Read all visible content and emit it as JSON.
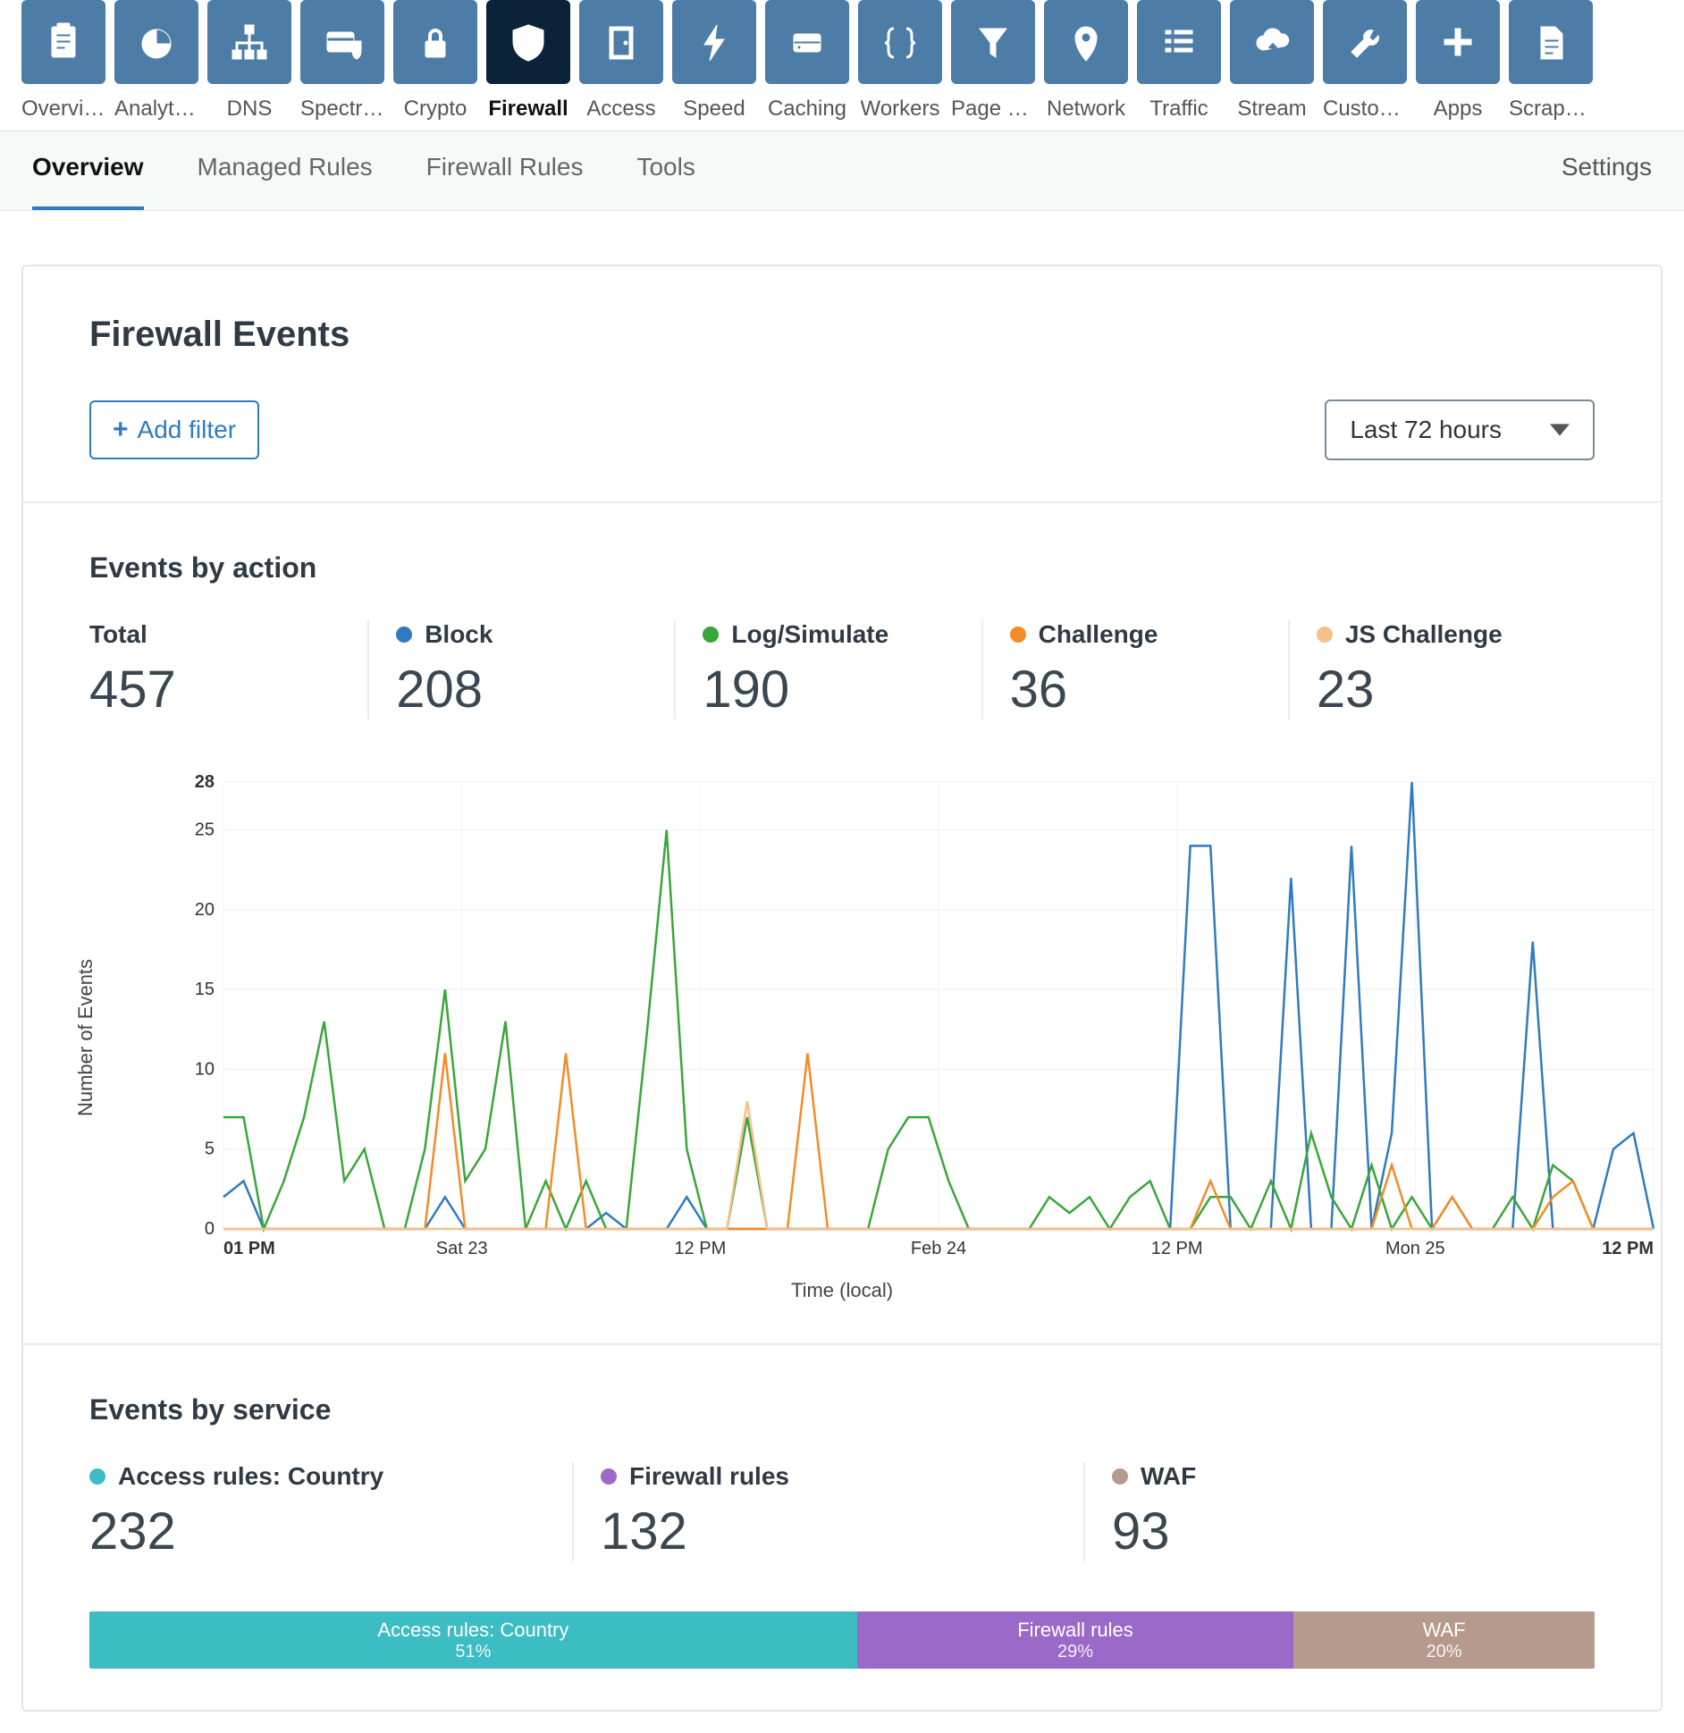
{
  "topnav": [
    {
      "label": "Overview",
      "icon": "clipboard"
    },
    {
      "label": "Analytics",
      "icon": "pie"
    },
    {
      "label": "DNS",
      "icon": "tree"
    },
    {
      "label": "Spectrum",
      "icon": "card-shield"
    },
    {
      "label": "Crypto",
      "icon": "lock"
    },
    {
      "label": "Firewall",
      "icon": "shield",
      "active": true
    },
    {
      "label": "Access",
      "icon": "door"
    },
    {
      "label": "Speed",
      "icon": "bolt"
    },
    {
      "label": "Caching",
      "icon": "drive"
    },
    {
      "label": "Workers",
      "icon": "braces"
    },
    {
      "label": "Page Rules",
      "icon": "funnel"
    },
    {
      "label": "Network",
      "icon": "pin"
    },
    {
      "label": "Traffic",
      "icon": "list"
    },
    {
      "label": "Stream",
      "icon": "cloud"
    },
    {
      "label": "Custom P…",
      "icon": "wrench"
    },
    {
      "label": "Apps",
      "icon": "plus"
    },
    {
      "label": "Scrape S…",
      "icon": "doc"
    }
  ],
  "subtabs": [
    "Overview",
    "Managed Rules",
    "Firewall Rules",
    "Tools"
  ],
  "subtab_active": "Overview",
  "settings_label": "Settings",
  "header": {
    "title": "Firewall Events",
    "add_filter": "Add filter",
    "time_range": "Last 72 hours"
  },
  "events_by_action": {
    "title": "Events by action",
    "stats": [
      {
        "label": "Total",
        "value": 457,
        "color": null
      },
      {
        "label": "Block",
        "value": 208,
        "color": "#2f7bbf"
      },
      {
        "label": "Log/Simulate",
        "value": 190,
        "color": "#3aa63a"
      },
      {
        "label": "Challenge",
        "value": 36,
        "color": "#f28c28"
      },
      {
        "label": "JS Challenge",
        "value": 23,
        "color": "#f6c08b"
      }
    ]
  },
  "events_by_service": {
    "title": "Events by service",
    "stats": [
      {
        "label": "Access rules: Country",
        "value": 232,
        "pct": "51%",
        "color": "#3cbcc3"
      },
      {
        "label": "Firewall rules",
        "value": 132,
        "pct": "29%",
        "color": "#9b69c7"
      },
      {
        "label": "WAF",
        "value": 93,
        "pct": "20%",
        "color": "#b59a8d"
      }
    ]
  },
  "chart_data": {
    "type": "line",
    "title": "",
    "xlabel": "Time (local)",
    "ylabel": "Number of Events",
    "ylim": [
      0,
      28
    ],
    "y_ticks": [
      0,
      5,
      10,
      15,
      20,
      25,
      28
    ],
    "x_ticks": [
      "01 PM",
      "Sat 23",
      "12 PM",
      "Feb 24",
      "12 PM",
      "Mon 25",
      "12 PM"
    ],
    "x_count": 72,
    "series": [
      {
        "name": "Block",
        "color": "#2f7bbf",
        "values": [
          2,
          3,
          0,
          0,
          0,
          0,
          0,
          0,
          0,
          0,
          0,
          2,
          0,
          0,
          0,
          0,
          0,
          0,
          0,
          1,
          0,
          0,
          0,
          2,
          0,
          0,
          0,
          0,
          0,
          0,
          0,
          0,
          0,
          0,
          0,
          0,
          0,
          0,
          0,
          0,
          0,
          0,
          0,
          0,
          0,
          0,
          0,
          0,
          24,
          24,
          0,
          0,
          0,
          22,
          0,
          0,
          24,
          0,
          6,
          28,
          0,
          0,
          0,
          0,
          0,
          18,
          0,
          0,
          0,
          5,
          6,
          0
        ]
      },
      {
        "name": "Log/Simulate",
        "color": "#3aa63a",
        "values": [
          7,
          7,
          0,
          3,
          7,
          13,
          3,
          5,
          0,
          0,
          5,
          15,
          3,
          5,
          13,
          0,
          3,
          0,
          3,
          0,
          0,
          12,
          25,
          5,
          0,
          0,
          7,
          0,
          0,
          0,
          0,
          0,
          0,
          5,
          7,
          7,
          3,
          0,
          0,
          0,
          0,
          2,
          1,
          2,
          0,
          2,
          3,
          0,
          0,
          2,
          2,
          0,
          3,
          0,
          6,
          2,
          0,
          4,
          0,
          2,
          0,
          2,
          0,
          0,
          2,
          0,
          4,
          3,
          0,
          0,
          0,
          0
        ]
      },
      {
        "name": "Challenge",
        "color": "#f28c28",
        "values": [
          0,
          0,
          0,
          0,
          0,
          0,
          0,
          0,
          0,
          0,
          0,
          11,
          0,
          0,
          0,
          0,
          0,
          11,
          0,
          0,
          0,
          0,
          0,
          0,
          0,
          0,
          0,
          0,
          0,
          11,
          0,
          0,
          0,
          0,
          0,
          0,
          0,
          0,
          0,
          0,
          0,
          0,
          0,
          0,
          0,
          0,
          0,
          0,
          0,
          3,
          0,
          0,
          0,
          0,
          0,
          0,
          0,
          0,
          4,
          0,
          0,
          2,
          0,
          0,
          0,
          0,
          2,
          3,
          0,
          0,
          0,
          0
        ]
      },
      {
        "name": "JS Challenge",
        "color": "#f6c08b",
        "values": [
          0,
          0,
          0,
          0,
          0,
          0,
          0,
          0,
          0,
          0,
          0,
          0,
          0,
          0,
          0,
          0,
          0,
          0,
          0,
          0,
          0,
          0,
          0,
          0,
          0,
          0,
          8,
          0,
          0,
          0,
          0,
          0,
          0,
          0,
          0,
          0,
          0,
          0,
          0,
          0,
          0,
          0,
          0,
          0,
          0,
          0,
          0,
          0,
          0,
          0,
          0,
          0,
          0,
          0,
          0,
          0,
          0,
          0,
          0,
          0,
          0,
          0,
          0,
          0,
          0,
          0,
          0,
          0,
          0,
          0,
          0,
          0
        ]
      }
    ]
  }
}
